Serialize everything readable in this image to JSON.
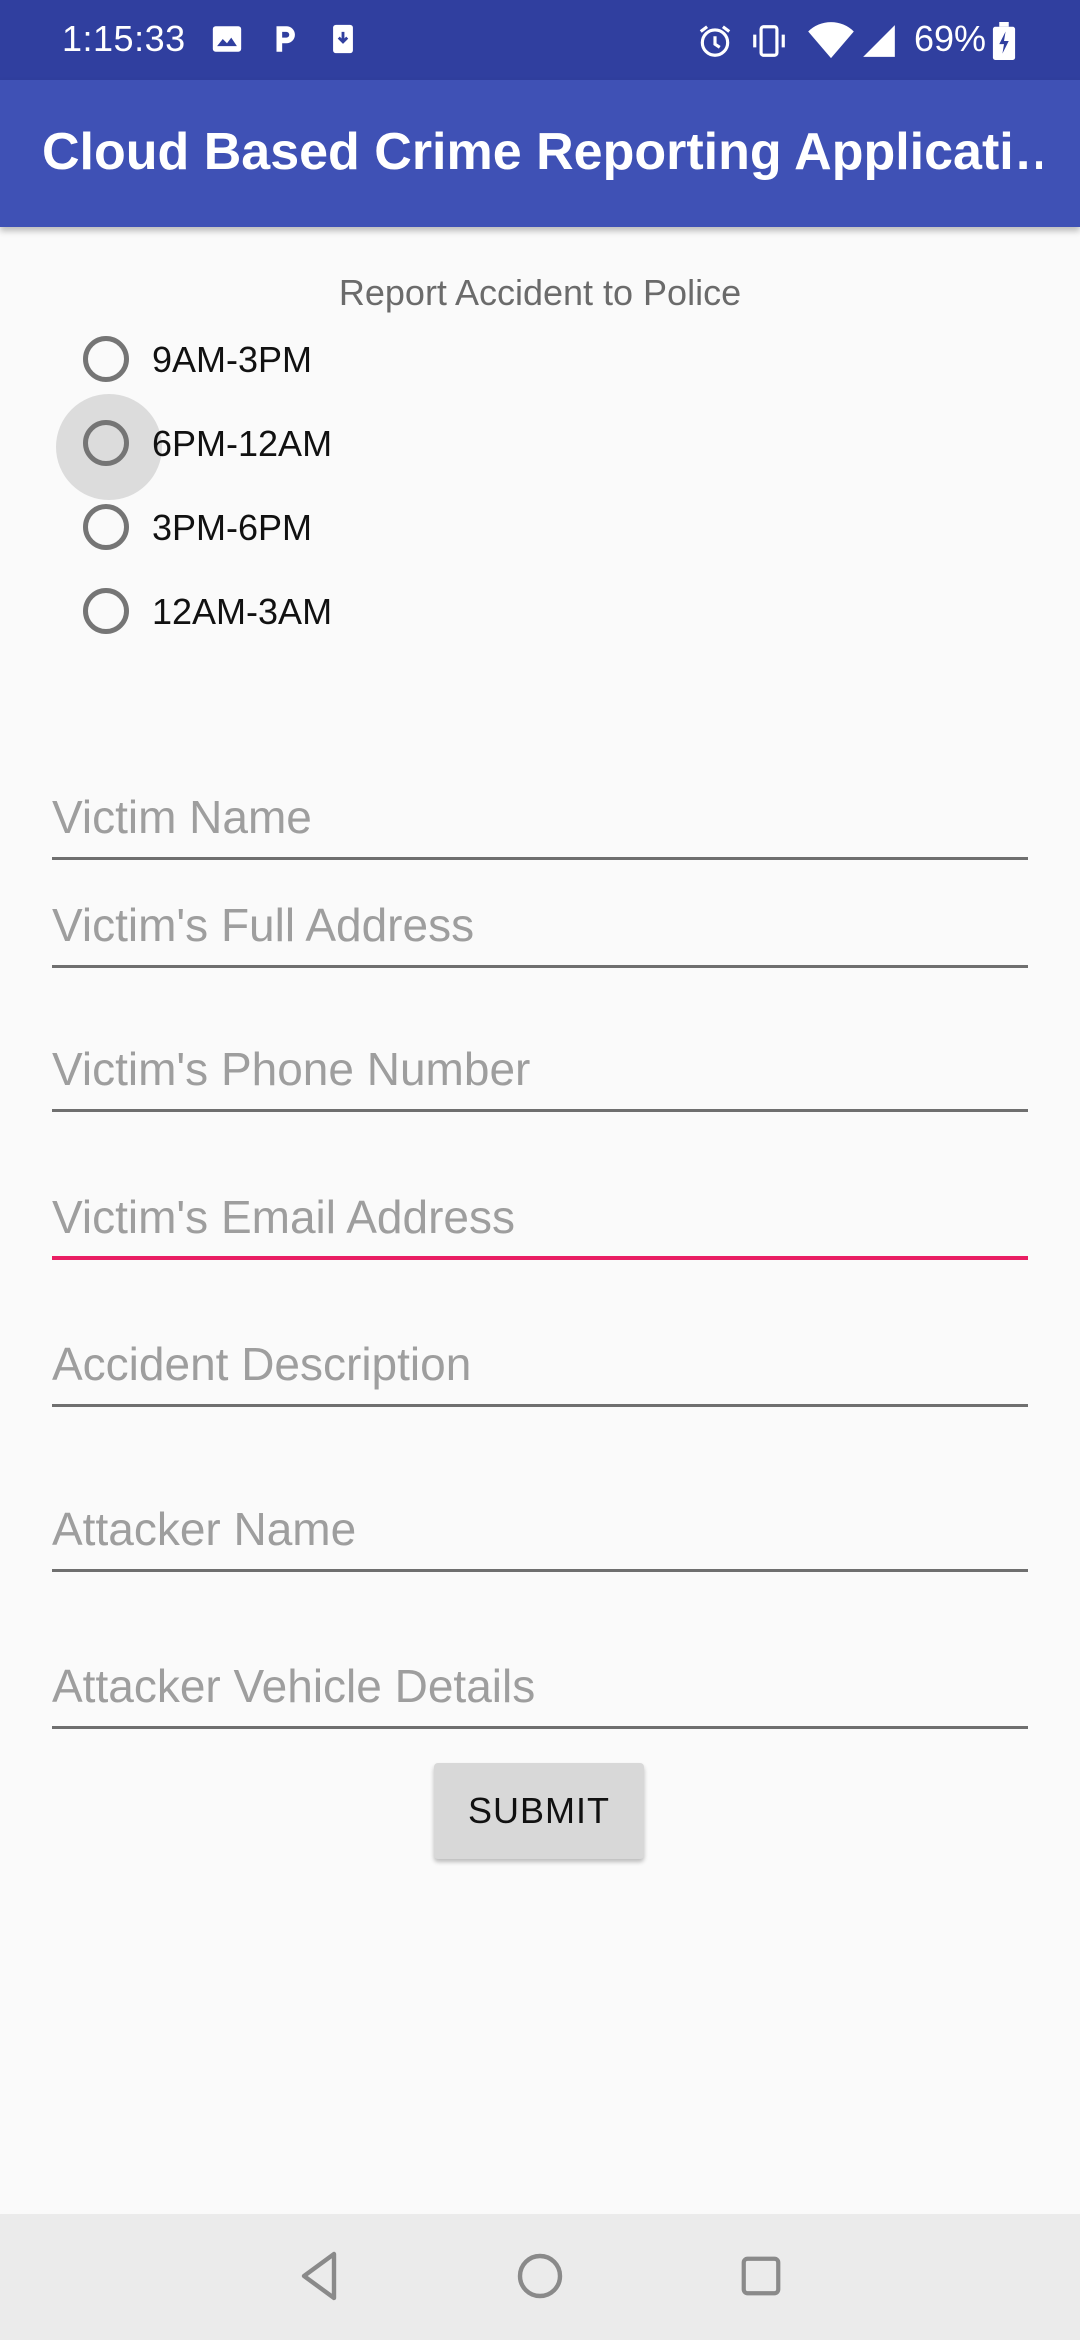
{
  "status_bar": {
    "time": "1:15:33",
    "battery_percent": "69%",
    "icons": [
      "image-icon",
      "parking-icon",
      "download-icon",
      "alarm-icon",
      "vibrate-icon",
      "wifi-icon",
      "signal-icon",
      "battery-charging-icon"
    ]
  },
  "app_bar": {
    "title": "Cloud Based Crime Reporting Applicati…",
    "color": "#3f51b5"
  },
  "form": {
    "heading": "Report Accident to Police",
    "radio_options": [
      {
        "label": "9AM-3PM",
        "selected": false
      },
      {
        "label": "6PM-12AM",
        "selected": false,
        "pressed": true
      },
      {
        "label": "3PM-6PM",
        "selected": false
      },
      {
        "label": "12AM-3AM",
        "selected": false
      }
    ],
    "fields": {
      "victim_name": {
        "value": "",
        "placeholder": "Victim Name"
      },
      "victim_address": {
        "value": "",
        "placeholder": "Victim's Full Address"
      },
      "victim_phone": {
        "value": "",
        "placeholder": "Victim's Phone Number"
      },
      "victim_email": {
        "value": "",
        "placeholder": "Victim's Email Address",
        "focused": true
      },
      "accident_description": {
        "value": "",
        "placeholder": "Accident Description"
      },
      "attacker_name": {
        "value": "",
        "placeholder": "Attacker Name"
      },
      "attacker_vehicle": {
        "value": "",
        "placeholder": "Attacker Vehicle Details"
      }
    },
    "submit_label": "SUBMIT",
    "focus_color": "#e91e63"
  },
  "nav_bar": {
    "buttons": [
      "back-icon",
      "home-icon",
      "recents-icon"
    ]
  }
}
